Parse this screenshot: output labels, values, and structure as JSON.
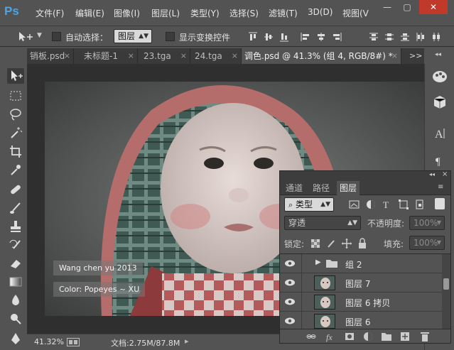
{
  "app": {
    "logo": "Ps"
  },
  "menu": {
    "items": [
      "文件(F)",
      "编辑(E)",
      "图像(I)",
      "图层(L)",
      "类型(Y)",
      "选择(S)",
      "滤镜(T)",
      "3D(D)",
      "视图(V"
    ]
  },
  "window_controls": {
    "minimize": "—",
    "restore": "▢",
    "close": "✕"
  },
  "options": {
    "auto_select_label": "自动选择：",
    "auto_select_value": "图层",
    "show_transform_label": "显示变换控件"
  },
  "tabs": [
    {
      "label": "销板.psd",
      "close": "×"
    },
    {
      "label": "未标题-1",
      "close": "×"
    },
    {
      "label": "23.tga",
      "close": "×"
    },
    {
      "label": "24.tga",
      "close": "×"
    },
    {
      "label": "调色.psd @ 41.3% (组 4, RGB/8#) *",
      "close": "×"
    }
  ],
  "tabs_overflow": ">>",
  "canvas": {
    "watermark_line1": "Wang chen yu 2013",
    "watermark_line2": "Color: Popeyes ~ XU"
  },
  "status": {
    "zoom": "41.32%",
    "doc_info": "文档:2.75M/87.8M"
  },
  "layers_panel": {
    "tabs": [
      "通道",
      "路径",
      "图层"
    ],
    "filter_label": "类型",
    "blend_mode": "穿透",
    "opacity_label": "不透明度:",
    "opacity_value": "100%",
    "lock_label": "锁定:",
    "fill_label": "填充:",
    "fill_value": "100%",
    "layers": [
      {
        "name": "组 2",
        "type": "group"
      },
      {
        "name": "图层 7",
        "type": "layer"
      },
      {
        "name": "图层 6 拷贝",
        "type": "layer"
      },
      {
        "name": "图层 6",
        "type": "layer"
      }
    ]
  },
  "colors": {
    "accent": "#4fa3e0",
    "panel_bg": "#535353",
    "dark_bg": "#2f2f2f"
  }
}
